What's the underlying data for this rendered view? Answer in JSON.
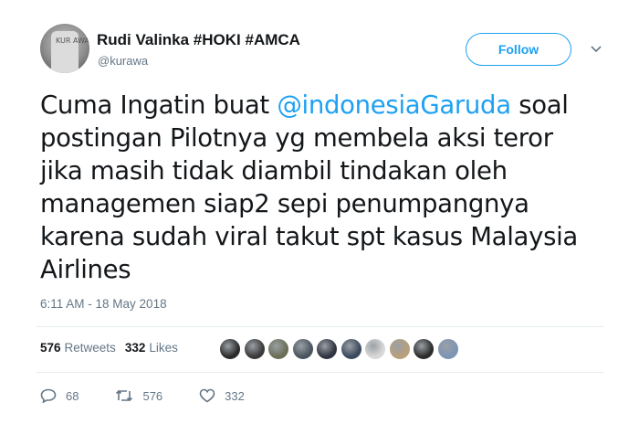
{
  "user": {
    "name": "Rudi Valinka #HOKI #AMCA",
    "handle": "@kurawa",
    "avatar_text": "KUR AWA"
  },
  "follow_label": "Follow",
  "tweet": {
    "before": "Cuma Ingatin buat ",
    "mention": "@indonesiaGaruda",
    "after": " soal postingan Pilotnya yg membela aksi teror jika masih tidak diambil tindakan oleh managemen siap2 sepi penumpangnya karena sudah viral takut spt kasus Malaysia Airlines"
  },
  "timestamp": "6:11 AM - 18 May 2018",
  "stats": {
    "retweets_count": "576",
    "retweets_label": "Retweets",
    "likes_count": "332",
    "likes_label": "Likes"
  },
  "likers": [
    "#2b2b2b",
    "#3a3a3a",
    "#6b6e55",
    "#4a5560",
    "#2f3440",
    "#3b4a5c",
    "#d8d8d8",
    "#b9a07a",
    "#2c2c2c",
    "#7d95b5"
  ],
  "actions": {
    "replies": "68",
    "retweets": "576",
    "likes": "332"
  },
  "colors": {
    "accent": "#1da1f2",
    "muted": "#657786",
    "text": "#14171a"
  }
}
